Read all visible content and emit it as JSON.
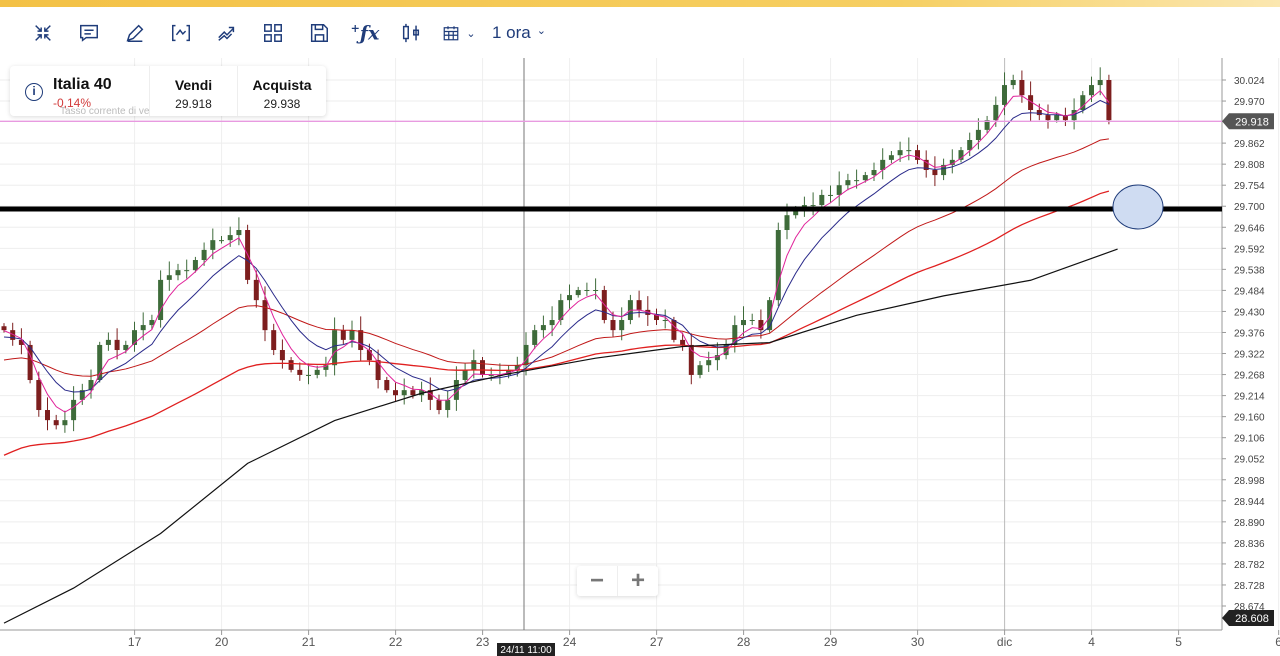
{
  "toolbar": {
    "icons": [
      "collapse-icon",
      "comment-icon",
      "pencil-icon",
      "indicator-icon",
      "trend-icon",
      "layout-grid-icon",
      "save-icon",
      "function-icon",
      "candle-type-icon",
      "calendar-icon"
    ],
    "interval": "1 ora"
  },
  "instrument": {
    "name": "Italia 40",
    "change": "-0,14%",
    "subtitle": "Tasso corrente di ve",
    "sell_label": "Vendi",
    "sell": "29.918",
    "buy_label": "Acquista",
    "buy": "29.938"
  },
  "zoom": {
    "minus": "−",
    "plus": "+"
  },
  "colors": {
    "up": "#3e6b3a",
    "down": "#7d1e1e",
    "ma_fast": "#e0229a",
    "ma_mid": "#2a2a8a",
    "ma_slow": "#c01818",
    "ma_slow2": "#e02020",
    "ma_long": "#111111",
    "price_line": "#e89be0"
  },
  "chart_data": {
    "type": "candlestick",
    "y_ticks": [
      "30.024",
      "29.970",
      "29.862",
      "29.808",
      "29.754",
      "29.700",
      "29.646",
      "29.592",
      "29.538",
      "29.484",
      "29.430",
      "29.376",
      "29.322",
      "29.268",
      "29.214",
      "29.160",
      "29.106",
      "29.052",
      "28.998",
      "28.944",
      "28.890",
      "28.836",
      "28.782",
      "28.728",
      "28.674"
    ],
    "ylim": [
      28.58,
      30.08
    ],
    "x_labels": [
      {
        "i": 8,
        "label": "17"
      },
      {
        "i": 18,
        "label": "20"
      },
      {
        "i": 28,
        "label": "21"
      },
      {
        "i": 38,
        "label": "22"
      },
      {
        "i": 48,
        "label": "23"
      },
      {
        "i": 58,
        "label": "24"
      },
      {
        "i": 68,
        "label": "27"
      },
      {
        "i": 78,
        "label": "28"
      },
      {
        "i": 88,
        "label": "29"
      },
      {
        "i": 98,
        "label": "30"
      },
      {
        "i": 108,
        "label": "dic"
      },
      {
        "i": 118,
        "label": "4"
      },
      {
        "i": 128,
        "label": "5"
      },
      {
        "i": 139.5,
        "label": "6"
      }
    ],
    "current_price": "29.918",
    "low_marker": "28.608",
    "crosshair_label": "24/11 11:00",
    "crosshair_index": 60,
    "support_level": 29.693,
    "closes": [
      29.382,
      29.357,
      29.344,
      29.254,
      29.177,
      29.151,
      29.138,
      29.151,
      29.203,
      29.228,
      29.254,
      29.344,
      29.357,
      29.331,
      29.344,
      29.382,
      29.395,
      29.408,
      29.511,
      29.523,
      29.536,
      29.536,
      29.562,
      29.588,
      29.613,
      29.613,
      29.626,
      29.639,
      29.511,
      29.459,
      29.382,
      29.331,
      29.305,
      29.28,
      29.267,
      29.267,
      29.28,
      29.292,
      29.382,
      29.357,
      29.382,
      29.331,
      29.305,
      29.254,
      29.228,
      29.215,
      29.228,
      29.215,
      29.228,
      29.203,
      29.177,
      29.203,
      29.254,
      29.28,
      29.305,
      29.267,
      29.267,
      29.267,
      29.28,
      29.292,
      29.344,
      29.382,
      29.395,
      29.408,
      29.459,
      29.472,
      29.485,
      29.485,
      29.485,
      29.408,
      29.382,
      29.408,
      29.459,
      29.434,
      29.421,
      29.408,
      29.408,
      29.357,
      29.344,
      29.267,
      29.292,
      29.305,
      29.318,
      29.344,
      29.395,
      29.408,
      29.408,
      29.382,
      29.459,
      29.639,
      29.677,
      29.69,
      29.703,
      29.703,
      29.729,
      29.729,
      29.754,
      29.767,
      29.767,
      29.78,
      29.793,
      29.819,
      29.831,
      29.844,
      29.844,
      29.819,
      29.793,
      29.78,
      29.806,
      29.819,
      29.844,
      29.87,
      29.896,
      29.921,
      29.96,
      30.011,
      30.024,
      29.985,
      29.947,
      29.934,
      29.921,
      29.934,
      29.921,
      29.947,
      29.985,
      30.011,
      30.024,
      29.921
    ],
    "ma_long_points": [
      [
        0,
        28.63
      ],
      [
        8,
        28.72
      ],
      [
        18,
        28.86
      ],
      [
        28,
        29.04
      ],
      [
        38,
        29.15
      ],
      [
        48,
        29.22
      ],
      [
        58,
        29.27
      ],
      [
        68,
        29.31
      ],
      [
        78,
        29.34
      ],
      [
        88,
        29.35
      ],
      [
        98,
        29.42
      ],
      [
        108,
        29.47
      ],
      [
        118,
        29.51
      ],
      [
        128,
        29.59
      ]
    ],
    "ma_seeds": {
      "fast": 29.38,
      "mid": 29.36,
      "slow": 29.3,
      "slow2": 29.05
    }
  }
}
